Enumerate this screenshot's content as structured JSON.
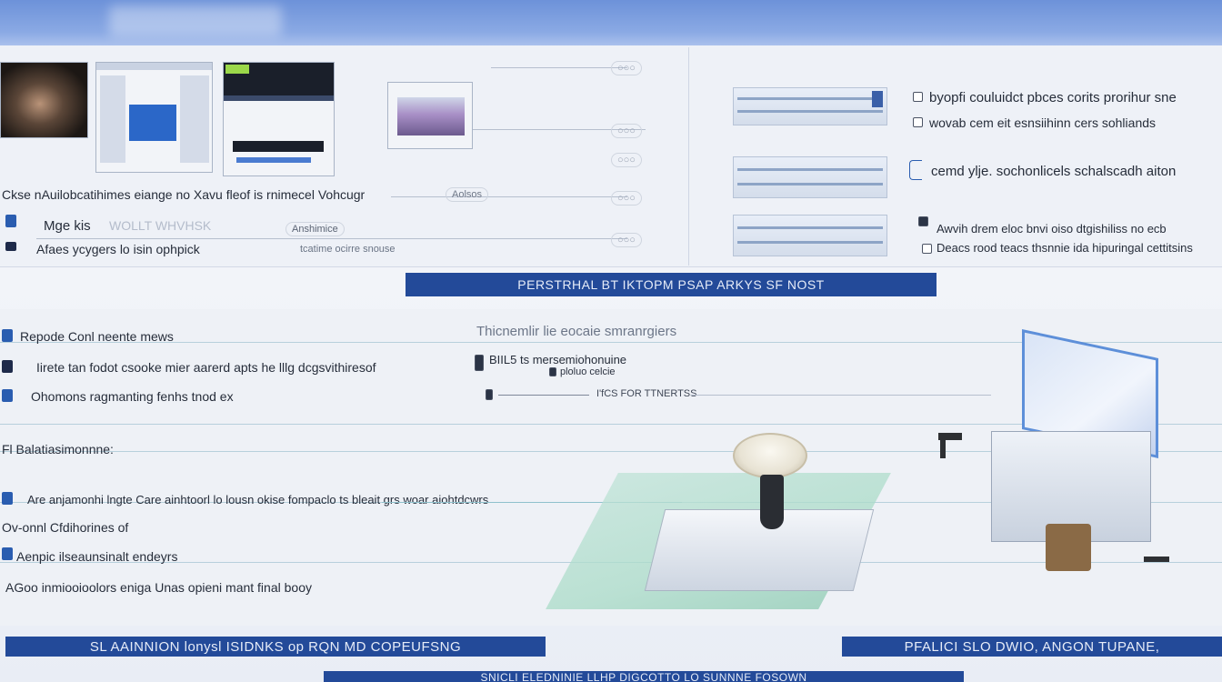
{
  "colors": {
    "header_band": "#7b9de0",
    "banner": "#234a99",
    "panel_bg": "#eef1f7",
    "accent_teal": "#8fc1cc"
  },
  "upper_left": {
    "row1": {
      "caption": "Ckse nAuilobcatihimes eiange no Xavu fleof is rnimecel Vohcugr",
      "pill": "Aolsos"
    },
    "row2": {
      "heading": "Mge kis",
      "subtext": "Afaes ycygers lo isin ophpick",
      "callout": "Anshimice",
      "callout_faded": "tcatime ocirre snouse"
    }
  },
  "upper_right": {
    "items": [
      {
        "text": "byopfi couluidct pbces corits prorihur sne"
      },
      {
        "text": "wovab cem eit esnsiihinn cers sohliands"
      },
      {
        "text": "cemd ylje. sochonlicels schalscadh aiton"
      },
      {
        "text": "Awvih drem eloc bnvi oiso dtgishiliss no ecb"
      },
      {
        "text": "Deacs rood teacs thsnnie ida hipuringal cettitsins"
      }
    ]
  },
  "banners": {
    "middle": "PERSTRHAL BT IKTOPM PSAP ARKYS SF NOST",
    "bottom_left": "SL AAINNION lonysl ISIDNKS op RQN MD COPEUFSNG",
    "bottom_right": "PFALICI SLO DWIO, ANGON TUPANE,",
    "bottom_center": "SNICLI ELEDNINIE LLHP DIGCOTTO LO SUNNNE FOSOWN"
  },
  "lower": {
    "section_label": "Thicnemlir lie eocaie smranrgiers",
    "items": [
      {
        "label": "Repode Conl neente mews",
        "kind": "blue-chk"
      },
      {
        "label": "Iirete tan fodot csooke mier aarerd apts he lllg dcgsvithiresof",
        "kind": "dark-chk"
      },
      {
        "label": "Ohomons ragmanting fenhs tnod ex",
        "kind": "blue-chk"
      },
      {
        "label": "Fl Balatiasimonnne:",
        "kind": "dark-chk"
      },
      {
        "label": "Are anjamonhi lngte Care ainhtoorl lo lousn okise fompaclo ts bleait grs woar aiohtdcwrs",
        "kind": "blue-chk"
      },
      {
        "label": "Ov-onnl Cfdihorines of",
        "kind": "dark-chk"
      },
      {
        "label": "Aenpic ilseaunsinalt endeyrs",
        "kind": "blue-chk"
      },
      {
        "label": "AGoo inmiooioolors eniga Unas opieni mant final booy",
        "kind": "dark-chk"
      }
    ],
    "mid_block": {
      "title": "BIIL5 ts mersemiohonuine",
      "subtitle": "ploluo celcie",
      "callout": "I'fCS FOR TTNERTSS"
    }
  }
}
